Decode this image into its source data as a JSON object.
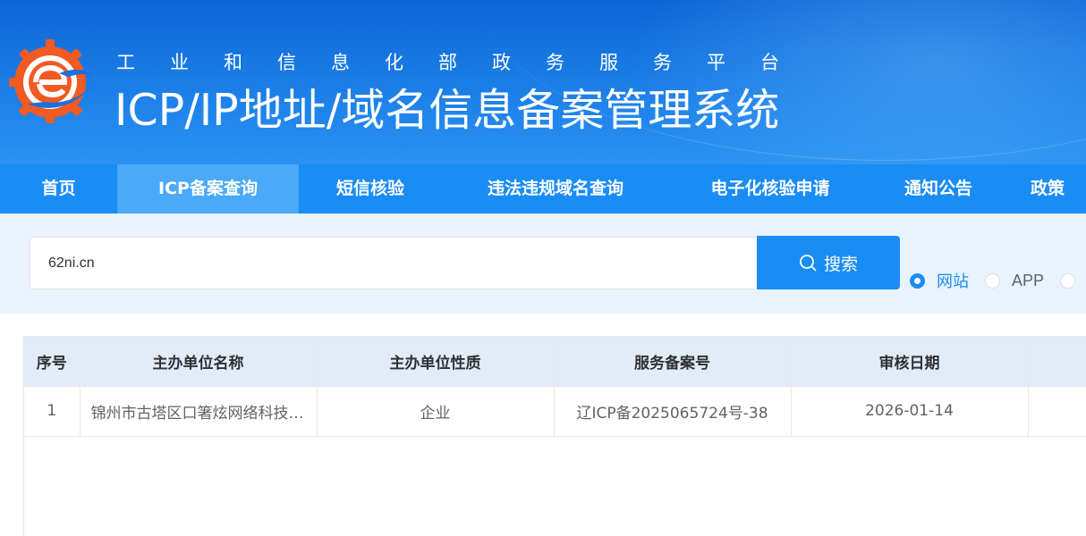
{
  "header": {
    "subtitle": "工业和信息化部政务服务平台",
    "title": "ICP/IP地址/域名信息备案管理系统"
  },
  "nav": {
    "items": [
      {
        "label": "首页",
        "active": false
      },
      {
        "label": "ICP备案查询",
        "active": true
      },
      {
        "label": "短信核验",
        "active": false
      },
      {
        "label": "违法违规域名查询",
        "active": false
      },
      {
        "label": "电子化核验申请",
        "active": false
      },
      {
        "label": "通知公告",
        "active": false
      },
      {
        "label": "政策",
        "active": false
      }
    ]
  },
  "search": {
    "value": "62ni.cn",
    "button_label": "搜索",
    "icon": "search-icon",
    "types": [
      {
        "label": "网站",
        "checked": true
      },
      {
        "label": "APP",
        "checked": false
      },
      {
        "label": "",
        "checked": false
      }
    ]
  },
  "table": {
    "columns": [
      "序号",
      "主办单位名称",
      "主办单位性质",
      "服务备案号",
      "审核日期",
      ""
    ],
    "rows": [
      [
        "1",
        "锦州市古塔区口箸炫网络科技有限公司",
        "企业",
        "辽ICP备2025065724号-38",
        "2026-01-14",
        ""
      ]
    ]
  },
  "colors": {
    "primary": "#1a8cf5",
    "nav_active": "#4aa9f8",
    "search_bg": "#e8f3fd",
    "table_header_bg": "#e2ebf8",
    "logo_orange": "#f15a22",
    "logo_blue": "#1e6fd9"
  }
}
